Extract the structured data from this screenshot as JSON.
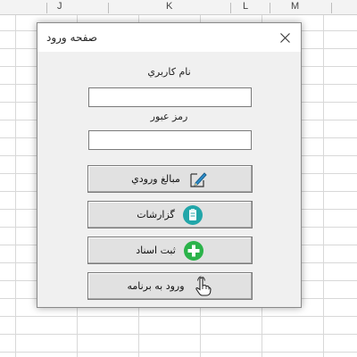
{
  "spreadsheet": {
    "column_letters": [
      "J",
      "K",
      "L",
      "M"
    ]
  },
  "dialog": {
    "title": "صفحه ورود",
    "username_label": "نام کاربري",
    "username_value": "",
    "password_label": "رمز عبور",
    "password_value": "",
    "buttons": [
      {
        "label": "مبالغ ورودي",
        "icon": "pencil-edit-icon"
      },
      {
        "label": "گزارشات",
        "icon": "clipboard-report-icon"
      },
      {
        "label": "ثبت اسناد",
        "icon": "plus-add-icon"
      },
      {
        "label": "ورود به برنامه",
        "icon": "hand-pointer-icon"
      }
    ]
  },
  "colors": {
    "dialog_bg": "#f0f0f0",
    "titlebar_bg": "#ffffff",
    "button_bg": "#e1e1e1",
    "report_icon": "#22a6a9",
    "add_icon": "#2bb34a",
    "pencil_icon": "#2a8fcf"
  }
}
